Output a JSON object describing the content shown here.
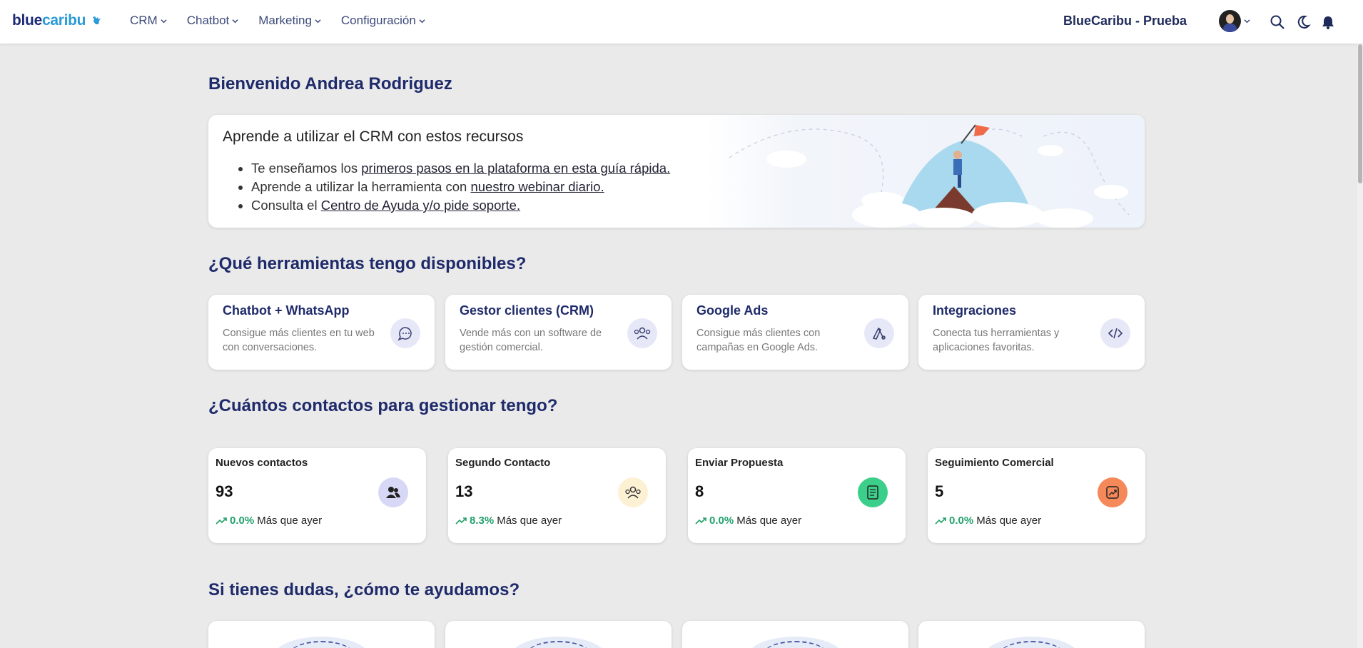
{
  "brand": {
    "part1": "blue",
    "part2": "caribu"
  },
  "nav": [
    {
      "label": "CRM"
    },
    {
      "label": "Chatbot"
    },
    {
      "label": "Marketing"
    },
    {
      "label": "Configuración"
    }
  ],
  "account": "BlueCaribu - Prueba",
  "welcome": "Bienvenido Andrea Rodriguez",
  "learn": {
    "title": "Aprende a utilizar el CRM con estos recursos",
    "items": [
      {
        "pre": "Te enseñamos los ",
        "link": "primeros pasos en la plataforma en esta guía rápida."
      },
      {
        "pre": "Aprende a utilizar la herramienta con ",
        "link": "nuestro webinar diario."
      },
      {
        "pre": "Consulta el ",
        "link": "Centro de Ayuda y/o pide soporte."
      }
    ]
  },
  "tools_title": "¿Qué herramientas tengo disponibles?",
  "tools": [
    {
      "title": "Chatbot + WhatsApp",
      "desc": "Consigue más clientes en tu web con conversaciones.",
      "icon": "chat-icon"
    },
    {
      "title": "Gestor clientes (CRM)",
      "desc": "Vende más con un software de gestión comercial.",
      "icon": "users-icon"
    },
    {
      "title": "Google Ads",
      "desc": "Consigue más clientes con campañas en Google Ads.",
      "icon": "google-ads-icon"
    },
    {
      "title": "Integraciones",
      "desc": "Conecta tus herramientas y aplicaciones favoritas.",
      "icon": "code-icon"
    }
  ],
  "contacts_title": "¿Cuántos contactos para gestionar tengo?",
  "stats": [
    {
      "title": "Nuevos contactos",
      "value": "93",
      "pct": "0.0%",
      "suffix": "Más que ayer",
      "color": "#d6d8f5",
      "icon": "people-icon"
    },
    {
      "title": "Segundo Contacto",
      "value": "13",
      "pct": "8.3%",
      "suffix": "Más que ayer",
      "color": "#fdf1d4",
      "icon": "group-icon"
    },
    {
      "title": "Enviar Propuesta",
      "value": "8",
      "pct": "0.0%",
      "suffix": "Más que ayer",
      "color": "#3ccf8a",
      "icon": "document-icon"
    },
    {
      "title": "Seguimiento Comercial",
      "value": "5",
      "pct": "0.0%",
      "suffix": "Más que ayer",
      "color": "#f5895a",
      "icon": "chart-icon"
    }
  ],
  "help_title": "Si tienes dudas, ¿cómo te ayudamos?"
}
